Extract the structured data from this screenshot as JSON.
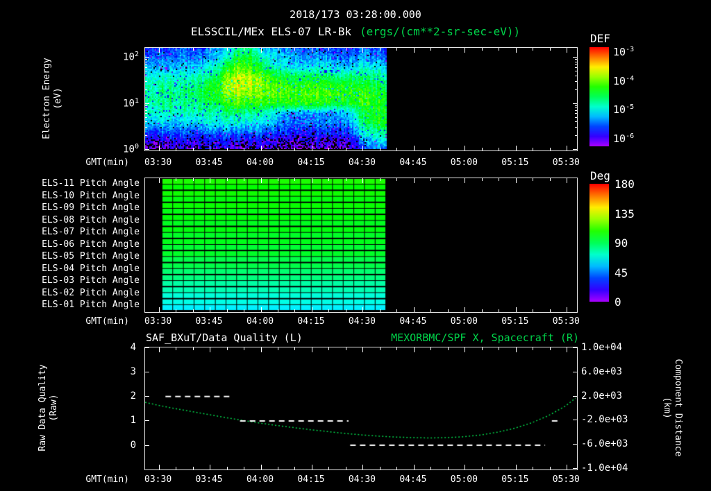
{
  "header": {
    "timestamp": "2018/173 03:28:00.000",
    "instrument": "ELSSCIL/MEx ELS-07 LR-Bk",
    "units": "(ergs/(cm**2-sr-sec-eV))"
  },
  "colors": {
    "background": "#000000",
    "text": "#ffffff",
    "accent_green": "#00d44a"
  },
  "time_axis": {
    "label": "GMT(min)",
    "range_min": [
      206,
      333
    ],
    "ticks": [
      {
        "min": 210,
        "label": "03:30"
      },
      {
        "min": 225,
        "label": "03:45"
      },
      {
        "min": 240,
        "label": "04:00"
      },
      {
        "min": 255,
        "label": "04:15"
      },
      {
        "min": 270,
        "label": "04:30"
      },
      {
        "min": 285,
        "label": "04:45"
      },
      {
        "min": 300,
        "label": "05:00"
      },
      {
        "min": 315,
        "label": "05:15"
      },
      {
        "min": 330,
        "label": "05:30"
      }
    ]
  },
  "spectrogram_panel": {
    "ylabel_lines": [
      "Electron Energy",
      "(eV)"
    ],
    "yticks": [
      {
        "base": "10",
        "exp": "2",
        "log": 2
      },
      {
        "base": "10",
        "exp": "1",
        "log": 1
      },
      {
        "base": "10",
        "exp": "0",
        "log": 0
      }
    ],
    "colorbar": {
      "title": "DEF",
      "ticks": [
        {
          "base": "10",
          "exp": "-3"
        },
        {
          "base": "10",
          "exp": "-4"
        },
        {
          "base": "10",
          "exp": "-5"
        },
        {
          "base": "10",
          "exp": "-6"
        }
      ]
    }
  },
  "pitch_panel": {
    "colorbar": {
      "title": "Deg",
      "ticks": [
        180,
        135,
        90,
        45,
        0
      ]
    }
  },
  "line_panel": {
    "ylabel_left_lines": [
      "Raw Data Quality",
      "(Raw)"
    ],
    "ylabel_right_lines": [
      "Component Distance",
      "(km)"
    ]
  },
  "chart_data": [
    {
      "type": "heatmap",
      "name": "electron-energy-spectrogram",
      "title": "ELSSCIL/MEx ELS-07 LR-Bk",
      "units_label": "(ergs/(cm**2-sr-sec-eV))",
      "xlabel": "GMT(min)",
      "ylabel": "Electron Energy (eV)",
      "y_scale": "log",
      "y_range_ev": [
        1,
        158
      ],
      "time_range_min": [
        206,
        277
      ],
      "value_range_log10": [
        -6.5,
        -3.0
      ],
      "energy_bins_ev": [
        150,
        95,
        60,
        38,
        24,
        15,
        9.5,
        6.0,
        3.8,
        2.4,
        1.5,
        1.0
      ],
      "values_log10": [
        [
          -5.9,
          -5.8,
          -5.9,
          -5.7,
          -5.8,
          -5.9,
          -5.6,
          -5.4,
          -4.9,
          -4.8,
          -5.3,
          -5.5,
          -5.6,
          -5.7,
          -5.8,
          -5.7,
          -5.8,
          -5.9,
          -5.8,
          -5.7,
          -5.8,
          -5.9
        ],
        [
          -5.7,
          -5.6,
          -5.7,
          -5.6,
          -5.7,
          -5.6,
          -5.4,
          -5.1,
          -4.6,
          -4.6,
          -5.0,
          -5.3,
          -5.4,
          -5.5,
          -5.6,
          -5.5,
          -5.6,
          -5.7,
          -5.6,
          -5.5,
          -5.6,
          -5.7
        ],
        [
          -5.5,
          -5.4,
          -5.5,
          -5.4,
          -5.4,
          -5.3,
          -5.1,
          -4.7,
          -4.3,
          -4.3,
          -4.7,
          -5.0,
          -5.2,
          -5.3,
          -5.3,
          -5.2,
          -5.3,
          -5.4,
          -5.3,
          -5.2,
          -5.3,
          -5.4
        ],
        [
          -5.2,
          -5.1,
          -5.2,
          -5.1,
          -5.1,
          -5.0,
          -4.8,
          -4.3,
          -3.9,
          -4.0,
          -4.2,
          -4.5,
          -4.7,
          -4.8,
          -4.8,
          -4.7,
          -4.8,
          -4.9,
          -4.8,
          -4.8,
          -4.9,
          -5.0
        ],
        [
          -5.0,
          -5.0,
          -4.9,
          -5.0,
          -4.9,
          -4.8,
          -4.5,
          -4.1,
          -3.8,
          -3.9,
          -4.1,
          -4.3,
          -4.4,
          -4.5,
          -4.4,
          -4.4,
          -4.5,
          -4.5,
          -4.5,
          -4.6,
          -4.7,
          -4.8
        ],
        [
          -4.9,
          -4.9,
          -4.8,
          -4.9,
          -4.8,
          -4.7,
          -4.5,
          -4.2,
          -4.0,
          -4.1,
          -4.2,
          -4.3,
          -4.3,
          -4.4,
          -4.3,
          -4.3,
          -4.4,
          -4.4,
          -4.4,
          -4.4,
          -4.5,
          -4.6
        ],
        [
          -4.9,
          -4.9,
          -4.9,
          -4.9,
          -4.9,
          -4.8,
          -4.7,
          -4.5,
          -4.3,
          -4.4,
          -4.4,
          -4.5,
          -4.5,
          -4.5,
          -4.4,
          -4.5,
          -4.5,
          -4.6,
          -4.5,
          -4.4,
          -4.5,
          -4.5
        ],
        [
          -5.1,
          -5.1,
          -5.0,
          -5.1,
          -5.1,
          -5.0,
          -5.0,
          -4.9,
          -4.8,
          -4.9,
          -5.0,
          -5.2,
          -5.5,
          -5.6,
          -5.6,
          -5.5,
          -5.6,
          -5.5,
          -5.2,
          -4.7,
          -4.6,
          -4.6
        ],
        [
          -5.3,
          -5.3,
          -5.4,
          -5.3,
          -5.3,
          -5.3,
          -5.2,
          -5.2,
          -5.1,
          -5.2,
          -5.3,
          -5.4,
          -5.6,
          -5.7,
          -5.7,
          -5.6,
          -5.6,
          -5.6,
          -5.4,
          -4.8,
          -4.6,
          -4.5
        ],
        [
          -5.7,
          -5.8,
          -5.7,
          -5.7,
          -5.8,
          -5.7,
          -5.6,
          -5.6,
          -5.6,
          -5.6,
          -5.7,
          -5.8,
          -5.9,
          -5.9,
          -6.0,
          -5.9,
          -5.9,
          -5.9,
          -5.7,
          -5.1,
          -4.9,
          -4.8
        ],
        [
          -6.1,
          -6.2,
          -6.1,
          -6.0,
          -6.1,
          -6.2,
          -6.0,
          -6.0,
          -6.1,
          -6.0,
          -6.1,
          -6.2,
          -6.2,
          -6.3,
          -6.2,
          -6.2,
          -6.3,
          -6.2,
          -6.1,
          -5.6,
          -5.4,
          -5.3
        ],
        [
          -6.3,
          -6.4,
          -6.3,
          -6.2,
          -6.4,
          -6.3,
          -6.2,
          -6.3,
          -6.4,
          -6.2,
          -6.3,
          -6.4,
          -6.4,
          -6.5,
          -6.4,
          -6.3,
          -6.4,
          -6.4,
          -6.3,
          -5.9,
          -5.7,
          -5.6
        ]
      ]
    },
    {
      "type": "heatmap",
      "name": "pitch-angle-grid",
      "xlabel": "GMT(min)",
      "time_range_min": [
        211,
        277
      ],
      "grid_columns": 21,
      "value_units": "Deg",
      "value_range_deg": [
        0,
        180
      ],
      "rows": [
        {
          "label": "ELS-11 Pitch Angle",
          "pitch_deg": [
            107,
            103
          ]
        },
        {
          "label": "ELS-10 Pitch Angle",
          "pitch_deg": [
            105,
            101
          ]
        },
        {
          "label": "ELS-09 Pitch Angle",
          "pitch_deg": [
            104,
            100
          ]
        },
        {
          "label": "ELS-08 Pitch Angle",
          "pitch_deg": [
            102,
            98
          ]
        },
        {
          "label": "ELS-07 Pitch Angle",
          "pitch_deg": [
            101,
            97
          ]
        },
        {
          "label": "ELS-06 Pitch Angle",
          "pitch_deg": [
            99,
            95
          ]
        },
        {
          "label": "ELS-05 Pitch Angle",
          "pitch_deg": [
            97,
            92
          ]
        },
        {
          "label": "ELS-04 Pitch Angle",
          "pitch_deg": [
            92,
            86
          ]
        },
        {
          "label": "ELS-03 Pitch Angle",
          "pitch_deg": [
            84,
            78
          ]
        },
        {
          "label": "ELS-02 Pitch Angle",
          "pitch_deg": [
            76,
            70
          ]
        },
        {
          "label": "ELS-01 Pitch Angle",
          "pitch_deg": [
            68,
            62
          ]
        }
      ]
    },
    {
      "type": "line",
      "name": "quality-and-spacecraft-distance",
      "xlabel": "GMT(min)",
      "title_left": "SAF_BXuT/Data Quality (L)",
      "title_right": "MEXORBMC/SPF X, Spacecraft (R)",
      "left_axis": {
        "label": "Raw Data Quality (Raw)",
        "range": [
          -0.95,
          4
        ],
        "ticks": [
          4,
          3,
          2,
          1,
          0
        ]
      },
      "right_axis": {
        "label": "Component Distance (km)",
        "range": [
          -10000,
          10000
        ],
        "ticks": [
          {
            "value": 10000,
            "label": "1.0e+04"
          },
          {
            "value": 6000,
            "label": "6.0e+03"
          },
          {
            "value": 2000,
            "label": "2.0e+03"
          },
          {
            "value": -2000,
            "label": "-2.0e+03"
          },
          {
            "value": -6000,
            "label": "-6.0e+03"
          },
          {
            "value": -10000,
            "label": "-1.0e+04"
          }
        ]
      },
      "series": [
        {
          "name": "SAF_BXuT/Data Quality",
          "axis": "left",
          "color": "#ffffff",
          "line_style": "dashed",
          "segments": [
            {
              "t": [
                212,
                232
              ],
              "value": 2
            },
            {
              "t": [
                234,
                266
              ],
              "value": 1
            },
            {
              "t": [
                266.5,
                324
              ],
              "value": 0
            },
            {
              "t": [
                326,
                328.5
              ],
              "value": 1
            }
          ]
        },
        {
          "name": "MEXORBMC/SPF X Spacecraft",
          "axis": "right",
          "color": "#00d44a",
          "line_style": "dotted",
          "points_min_km": [
            [
              206,
              900
            ],
            [
              210,
              400
            ],
            [
              215,
              -150
            ],
            [
              220,
              -650
            ],
            [
              225,
              -1150
            ],
            [
              230,
              -1650
            ],
            [
              235,
              -2100
            ],
            [
              240,
              -2550
            ],
            [
              245,
              -2950
            ],
            [
              250,
              -3300
            ],
            [
              255,
              -3650
            ],
            [
              260,
              -3950
            ],
            [
              265,
              -4250
            ],
            [
              270,
              -4500
            ],
            [
              275,
              -4700
            ],
            [
              280,
              -4850
            ],
            [
              285,
              -4950
            ],
            [
              290,
              -5000
            ],
            [
              295,
              -4950
            ],
            [
              300,
              -4800
            ],
            [
              305,
              -4500
            ],
            [
              310,
              -4050
            ],
            [
              315,
              -3400
            ],
            [
              320,
              -2500
            ],
            [
              325,
              -1300
            ],
            [
              330,
              300
            ],
            [
              333,
              1600
            ]
          ]
        }
      ]
    }
  ]
}
